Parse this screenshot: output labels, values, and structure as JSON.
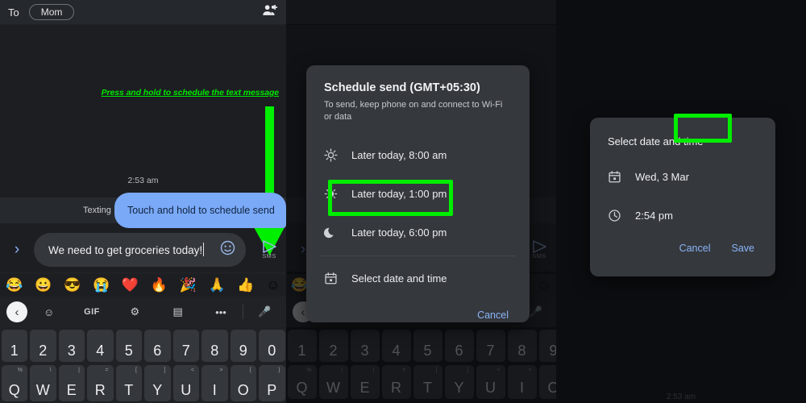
{
  "panel_left": {
    "topbar": {
      "to_label": "To",
      "recipient_chip": "Mom",
      "add_people_icon": "person-add-icon"
    },
    "annotation_hint": "Press and hold to schedule the text message",
    "timestamp": "2:53 am",
    "texting_label": "Texting",
    "message_bubble": "Touch and hold to schedule send",
    "composer": {
      "expand_icon": "chevron-right-icon",
      "input_value": "We need to get groceries today!",
      "emoji_icon": "emoji-smiley-icon",
      "send_icon": "send-arrow-icon",
      "send_label": "SMS"
    },
    "emoji_row": [
      "😂",
      "😀",
      "😎",
      "😭",
      "❤️",
      "🔥",
      "🎉",
      "🙏",
      "👍",
      "☺"
    ],
    "keyboard_toolbar": [
      {
        "name": "back-circle-icon",
        "label": "‹"
      },
      {
        "name": "sticker-icon",
        "label": "☺"
      },
      {
        "name": "gif-icon",
        "label": "GIF"
      },
      {
        "name": "settings-gear-icon",
        "label": "⚙"
      },
      {
        "name": "translate-icon",
        "label": "▤"
      },
      {
        "name": "more-options-icon",
        "label": "•••"
      },
      {
        "name": "microphone-icon",
        "label": "🎤"
      }
    ],
    "keyboard_number_row": [
      "1",
      "2",
      "3",
      "4",
      "5",
      "6",
      "7",
      "8",
      "9",
      "0"
    ],
    "keyboard_qwerty_row": [
      {
        "key": "Q",
        "alt": "%"
      },
      {
        "key": "W",
        "alt": "\\"
      },
      {
        "key": "E",
        "alt": "|"
      },
      {
        "key": "R",
        "alt": "="
      },
      {
        "key": "T",
        "alt": "["
      },
      {
        "key": "Y",
        "alt": "]"
      },
      {
        "key": "U",
        "alt": "<"
      },
      {
        "key": "I",
        "alt": ">"
      },
      {
        "key": "O",
        "alt": "{"
      },
      {
        "key": "P",
        "alt": "}"
      }
    ]
  },
  "panel_middle": {
    "dialog": {
      "title": "Schedule send (GMT+05:30)",
      "subtitle": "To send, keep phone on and connect to Wi-Fi or data",
      "options": [
        {
          "icon": "sun-icon",
          "glyph": "☀",
          "label": "Later today, 8:00 am"
        },
        {
          "icon": "half-sun-icon",
          "glyph": "◑",
          "label": "Later today, 1:00 pm"
        },
        {
          "icon": "moon-icon",
          "glyph": "☽",
          "label": "Later today, 6:00 pm"
        },
        {
          "icon": "calendar-icon",
          "glyph": "Ὄ5",
          "label": "Select date and time"
        }
      ],
      "cancel_label": "Cancel"
    },
    "highlight_target": "Select date and time"
  },
  "panel_right": {
    "dialog": {
      "title": "Select date and time",
      "date": {
        "icon": "calendar-icon",
        "value": "Wed, 3 Mar"
      },
      "time": {
        "icon": "clock-icon",
        "value": "2:54 pm"
      },
      "cancel_label": "Cancel",
      "save_label": "Save"
    },
    "background_timestamp": "2:53 am",
    "highlight_target": "Save"
  },
  "colors": {
    "highlight_green": "#00ee00",
    "accent_blue": "#8ab4f8",
    "bubble_blue": "#7aa9f7",
    "dialog_surface": "#35383d",
    "app_background": "#1c1e22"
  }
}
